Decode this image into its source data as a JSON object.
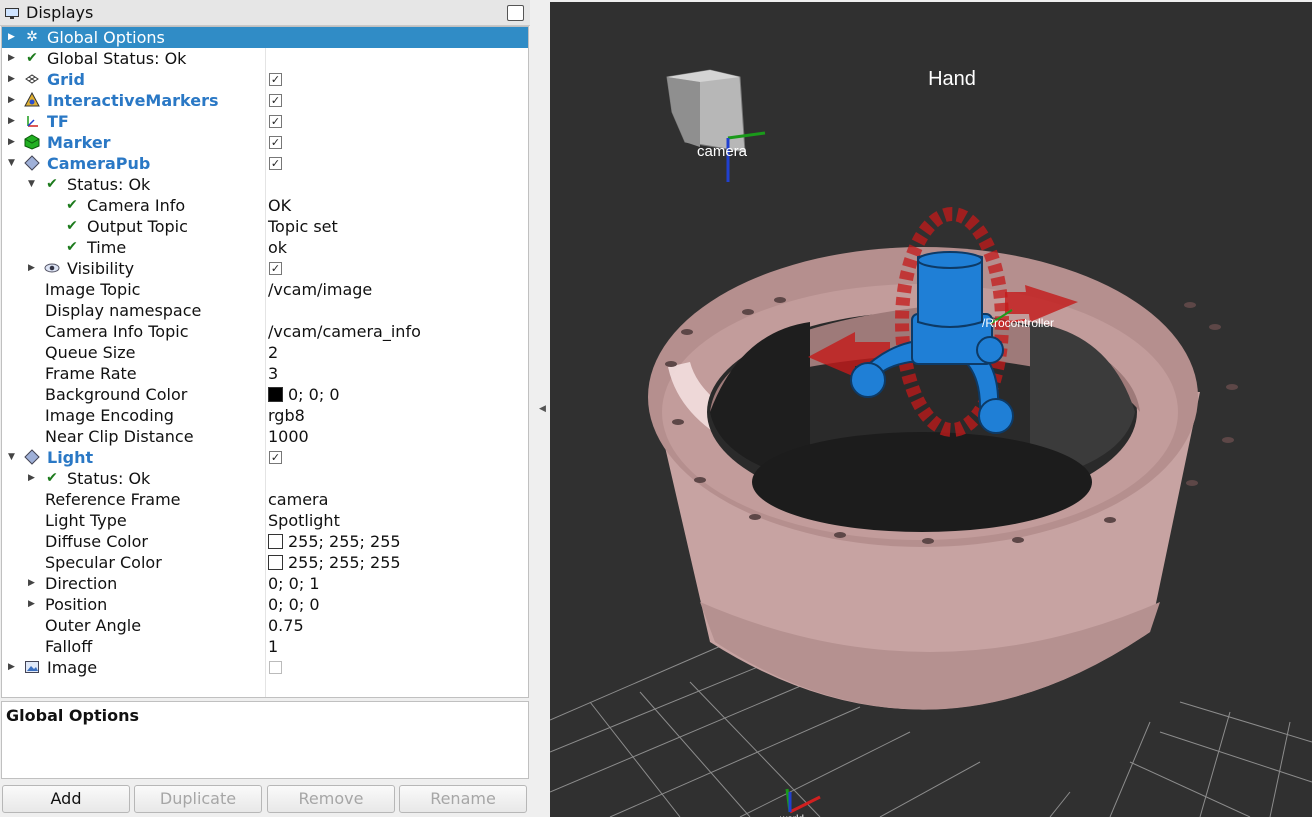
{
  "panel": {
    "title": "Displays"
  },
  "tree": {
    "global_options": "Global Options",
    "global_status": "Global Status: Ok",
    "grid": "Grid",
    "interactive_markers": "InteractiveMarkers",
    "tf": "TF",
    "marker": "Marker",
    "camera_pub": "CameraPub",
    "camera_pub_status": "Status: Ok",
    "camera_info": {
      "label": "Camera Info",
      "value": "OK"
    },
    "output_topic": {
      "label": "Output Topic",
      "value": "Topic set"
    },
    "time": {
      "label": "Time",
      "value": "ok"
    },
    "visibility": "Visibility",
    "image_topic": {
      "label": "Image Topic",
      "value": "/vcam/image"
    },
    "display_namespace": {
      "label": "Display namespace",
      "value": ""
    },
    "camera_info_topic": {
      "label": "Camera Info Topic",
      "value": "/vcam/camera_info"
    },
    "queue_size": {
      "label": "Queue Size",
      "value": "2"
    },
    "frame_rate": {
      "label": "Frame Rate",
      "value": "3"
    },
    "background_color": {
      "label": "Background Color",
      "value": "0; 0; 0",
      "color": "#000000"
    },
    "image_encoding": {
      "label": "Image Encoding",
      "value": "rgb8"
    },
    "near_clip": {
      "label": "Near Clip Distance",
      "value": "1000"
    },
    "light": "Light",
    "light_status": "Status: Ok",
    "reference_frame": {
      "label": "Reference Frame",
      "value": "camera"
    },
    "light_type": {
      "label": "Light Type",
      "value": "Spotlight"
    },
    "diffuse_color": {
      "label": "Diffuse Color",
      "value": "255; 255; 255",
      "color": "#ffffff"
    },
    "specular_color": {
      "label": "Specular Color",
      "value": "255; 255; 255",
      "color": "#ffffff"
    },
    "direction": {
      "label": "Direction",
      "value": "0; 0; 1"
    },
    "position": {
      "label": "Position",
      "value": "0; 0; 0"
    },
    "outer_angle": {
      "label": "Outer Angle",
      "value": "0.75"
    },
    "falloff": {
      "label": "Falloff",
      "value": "1"
    },
    "image": "Image"
  },
  "checks": {
    "grid": true,
    "interactive_markers": true,
    "tf": true,
    "marker": true,
    "camera_pub": true,
    "visibility": true,
    "light": true,
    "image": false
  },
  "description": {
    "title": "Global Options"
  },
  "buttons": {
    "add": "Add",
    "duplicate": "Duplicate",
    "remove": "Remove",
    "rename": "Rename"
  },
  "viewport": {
    "hand_label": "Hand",
    "camera_label": "camera",
    "controller_label": "/Rrocontroller",
    "world_label": "world"
  },
  "colors": {
    "selection": "#308cc6",
    "bold_label": "#2a78c5",
    "viewport_bg": "#303030",
    "ring": "#e7b0b0",
    "hand": "#1f7fd6",
    "marker_red": "#c41a1a"
  }
}
